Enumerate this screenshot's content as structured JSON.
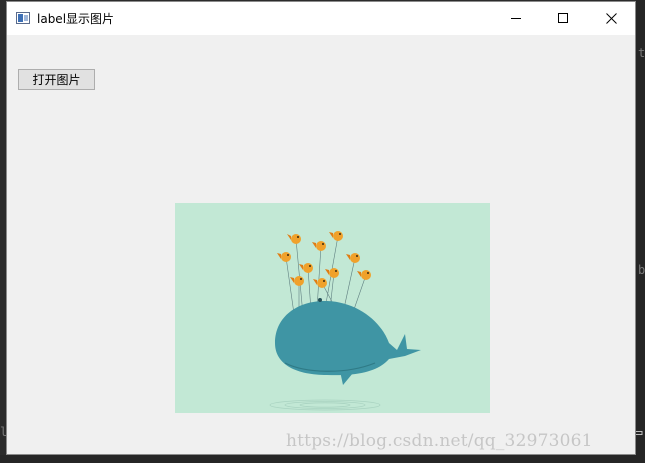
{
  "window": {
    "title": "label显示图片",
    "controls": {
      "minimize": "minimize-icon",
      "maximize": "maximize-icon",
      "close": "close-icon"
    }
  },
  "toolbar": {
    "open_image_label": "打开图片"
  },
  "image": {
    "subject": "whale-with-birds",
    "background_color": "#c2e8d5",
    "whale_color": "#3f95a4",
    "bird_color": "#f0a12b"
  },
  "watermark": {
    "text": "https://blog.csdn.net/qq_32973061"
  },
  "background_glyphs": [
    "t",
    "b",
    "l"
  ]
}
